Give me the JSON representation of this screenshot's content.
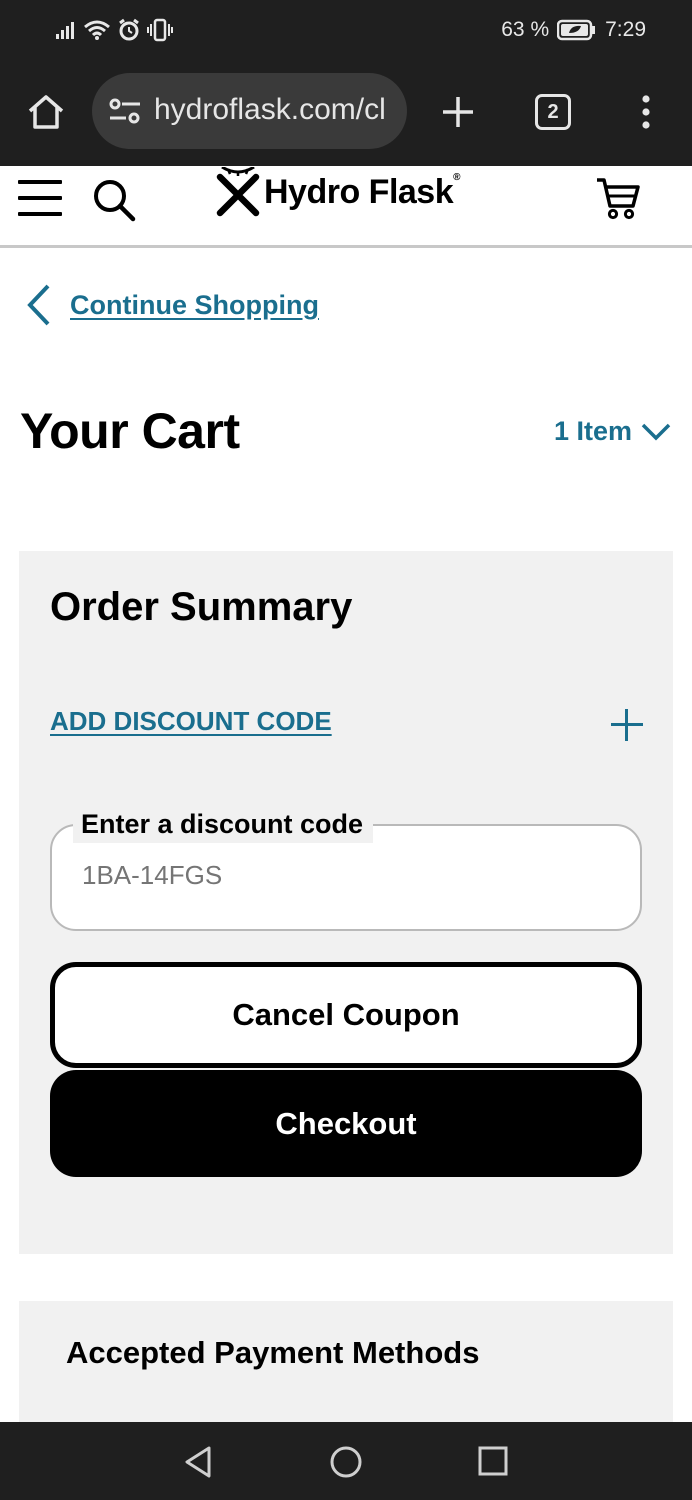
{
  "status_bar": {
    "battery_percent": "63 %",
    "time": "7:29",
    "icons": [
      "signal-icon",
      "wifi-icon",
      "alarm-icon",
      "vibrate-icon",
      "battery-saver-icon"
    ]
  },
  "browser": {
    "url": "hydroflask.com/cl",
    "tab_count": "2",
    "icons": [
      "home-icon",
      "site-settings-icon",
      "new-tab-plus-icon",
      "more-menu-icon"
    ]
  },
  "header": {
    "logo_text": "Hydro Flask",
    "logo_mark": "®",
    "icons": [
      "hamburger-menu-icon",
      "search-icon",
      "cart-icon"
    ]
  },
  "nav": {
    "continue_label": "Continue Shopping"
  },
  "cart": {
    "title": "Your Cart",
    "item_count": "1 Item"
  },
  "summary": {
    "title": "Order Summary",
    "discount_link": "ADD DISCOUNT CODE",
    "discount_field_label": "Enter a discount code",
    "discount_placeholder": "1BA-14FGS",
    "cancel_label": "Cancel Coupon",
    "checkout_label": "Checkout"
  },
  "payment": {
    "title": "Accepted Payment Methods"
  },
  "colors": {
    "accent": "#1a6e8e",
    "card_bg": "#f1f1f1",
    "system_bar": "#1f1f1f"
  }
}
